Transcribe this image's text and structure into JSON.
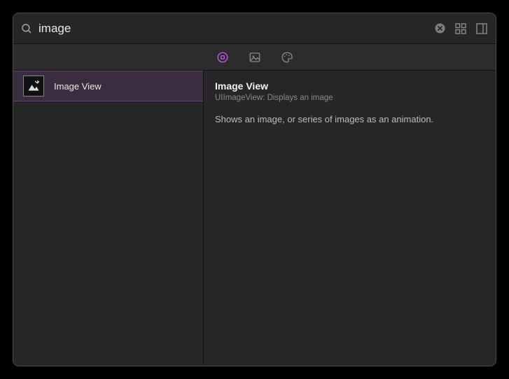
{
  "search": {
    "value": "image",
    "placeholder": ""
  },
  "segments": {
    "objects_label": "Objects",
    "media_label": "Media",
    "colors_label": "Colors"
  },
  "results": [
    {
      "label": "Image View",
      "selected": true
    }
  ],
  "detail": {
    "title": "Image View",
    "subtitle": "UIImageView: Displays an image",
    "description": "Shows an image, or series of images as an animation."
  }
}
